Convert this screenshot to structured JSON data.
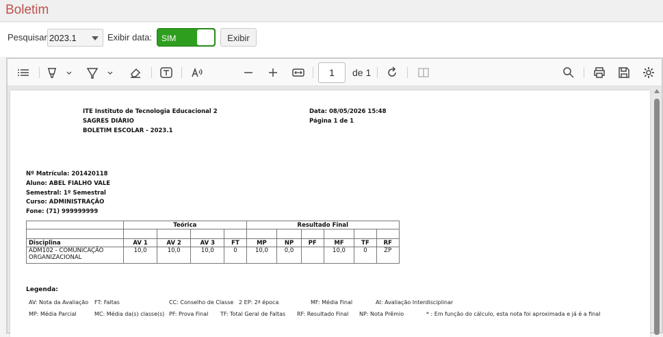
{
  "window": {
    "title": "Boletim"
  },
  "filter": {
    "search_label": "Pesquisar:",
    "period_value": "2023.1",
    "show_date_label": "Exibir data:",
    "toggle_label": "SIM",
    "show_button": "Exibir"
  },
  "viewer": {
    "page_number": "1",
    "page_of": "de 1"
  },
  "report": {
    "institution": "ITE Instituto de Tecnologia Educacional 2",
    "system": "SAGRES DIÁRIO",
    "report_title": "BOLETIM ESCOLAR - 2023.1",
    "date": "Data:  08/05/2026 15:48",
    "page": "Página 1 de 1",
    "matricula": "Nº Matrícula: 201420118",
    "aluno": "Aluno:  ABEL FIALHO VALE",
    "semestral": "Semestral:  1º Semestral",
    "curso": "Curso:  ADMINISTRAÇÃO",
    "fone": "Fone:  (71) 999999999"
  },
  "grades": {
    "group_teorica": "Teórica",
    "group_resultado": "Resultado Final",
    "headers": [
      "Disciplina",
      "AV 1",
      "AV 2",
      "AV 3",
      "FT",
      "MP",
      "NP",
      "PF",
      "MF",
      "TF",
      "RF"
    ],
    "rows": [
      [
        "ADM102 - COMUNICAÇÃO ORGANIZACIONAL",
        "10,0",
        "10,0",
        "10,0",
        "0",
        "10,0",
        "0,0",
        "",
        "10,0",
        "0",
        "ZP"
      ]
    ]
  },
  "legend": {
    "title": "Legenda:",
    "row1": [
      "AV: Nota da Avaliação",
      "FT: Faltas",
      "CC: Conselho de Classe",
      "2 EP: 2ª época",
      "MF: Média Final",
      "AI: Avaliação Interdisciplinar"
    ],
    "row2": [
      "MP: Média Parcial",
      "MC: Média da(s) classe(s)",
      "PF: Prova Final",
      "TF: Total Geral de Faltas",
      "RF: Resultado Final",
      "NP: Nota Prêmio",
      "* : Em função do cálculo, esta nota foi aproximada e já é a final"
    ]
  },
  "icons": {
    "accent_title": "#c0504d",
    "toggle_color": "#2e9e1e"
  }
}
